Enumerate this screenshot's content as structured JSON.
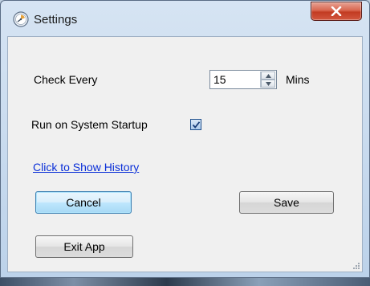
{
  "window": {
    "title": "Settings",
    "icon": "settings-app-icon",
    "close_icon": "close-icon"
  },
  "check_interval": {
    "label": "Check Every",
    "value": "15",
    "unit": "Mins"
  },
  "startup": {
    "label": "Run on System Startup",
    "checked": true
  },
  "history_link": "Click to Show History",
  "buttons": {
    "cancel": "Cancel",
    "save": "Save",
    "exit": "Exit App"
  },
  "colors": {
    "link": "#0a2fd8",
    "close_button": "#c23b22",
    "focus_border": "#3c7fb1"
  }
}
